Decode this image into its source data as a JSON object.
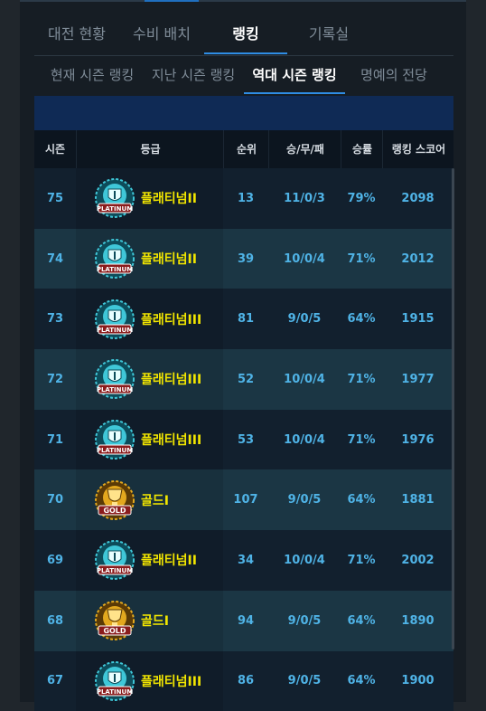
{
  "main_tabs": [
    {
      "label": "대전 현황"
    },
    {
      "label": "수비 배치"
    },
    {
      "label": "랭킹"
    },
    {
      "label": "기록실"
    }
  ],
  "sub_tabs": [
    {
      "label": "현재 시즌 랭킹"
    },
    {
      "label": "지난 시즌 랭킹"
    },
    {
      "label": "역대 시즌 랭킹"
    },
    {
      "label": "명예의 전당"
    }
  ],
  "table": {
    "headers": {
      "season": "시즌",
      "grade": "등급",
      "rank": "순위",
      "record": "승/무/패",
      "win_rate": "승률",
      "score": "랭킹 스코어"
    },
    "rows": [
      {
        "season": "75",
        "badge": "platinum-badge-icon",
        "badge_text": "PLATINUM",
        "grade": "플래티넘II",
        "rank": "13",
        "record": "11/0/3",
        "win_rate": "79%",
        "score": "2098"
      },
      {
        "season": "74",
        "badge": "platinum-badge-icon",
        "badge_text": "PLATINUM",
        "grade": "플래티넘II",
        "rank": "39",
        "record": "10/0/4",
        "win_rate": "71%",
        "score": "2012"
      },
      {
        "season": "73",
        "badge": "platinum-badge-icon",
        "badge_text": "PLATINUM",
        "grade": "플래티넘III",
        "rank": "81",
        "record": "9/0/5",
        "win_rate": "64%",
        "score": "1915"
      },
      {
        "season": "72",
        "badge": "platinum-badge-icon",
        "badge_text": "PLATINUM",
        "grade": "플래티넘III",
        "rank": "52",
        "record": "10/0/4",
        "win_rate": "71%",
        "score": "1977"
      },
      {
        "season": "71",
        "badge": "platinum-badge-icon",
        "badge_text": "PLATINUM",
        "grade": "플래티넘III",
        "rank": "53",
        "record": "10/0/4",
        "win_rate": "71%",
        "score": "1976"
      },
      {
        "season": "70",
        "badge": "gold-badge-icon",
        "badge_text": "GOLD",
        "grade": "골드I",
        "rank": "107",
        "record": "9/0/5",
        "win_rate": "64%",
        "score": "1881"
      },
      {
        "season": "69",
        "badge": "platinum-badge-icon",
        "badge_text": "PLATINUM",
        "grade": "플래티넘II",
        "rank": "34",
        "record": "10/0/4",
        "win_rate": "71%",
        "score": "2002"
      },
      {
        "season": "68",
        "badge": "gold-badge-icon",
        "badge_text": "GOLD",
        "grade": "골드I",
        "rank": "94",
        "record": "9/0/5",
        "win_rate": "64%",
        "score": "1890"
      },
      {
        "season": "67",
        "badge": "platinum-badge-icon",
        "badge_text": "PLATINUM",
        "grade": "플래티넘III",
        "rank": "86",
        "record": "9/0/5",
        "win_rate": "64%",
        "score": "1900"
      }
    ]
  },
  "colors": {
    "accent": "#2f8de4",
    "grade_text": "#f2e600",
    "cell_text": "#4fb3e6",
    "platinum": "#3fc7d8",
    "gold": "#e3a81e"
  }
}
